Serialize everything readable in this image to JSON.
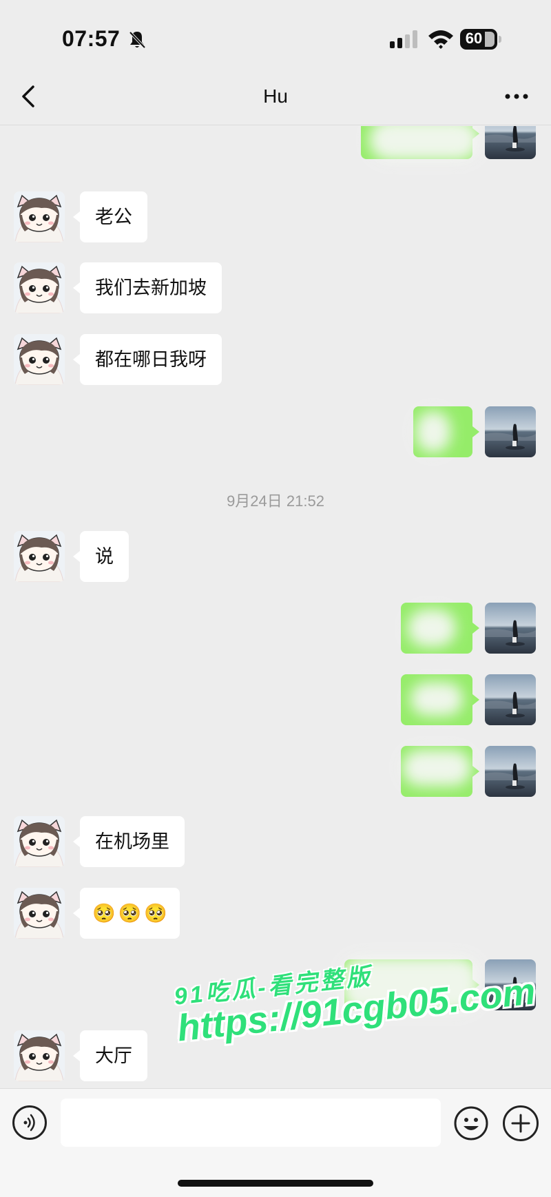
{
  "status_bar": {
    "time": "07:57",
    "battery": "60",
    "icons": [
      "bell-slash-icon",
      "cellular-signal-icon",
      "wifi-icon",
      "battery-icon"
    ]
  },
  "nav": {
    "title": "Hu",
    "back_icon": "chevron-left-icon",
    "more_icon": "more-dots-icon"
  },
  "messages": [
    {
      "side": "left",
      "text": "老公"
    },
    {
      "side": "left",
      "text": "我们去新加坡"
    },
    {
      "side": "left",
      "text": "都在哪日我呀"
    },
    {
      "side": "left",
      "text": "说"
    },
    {
      "side": "left",
      "text": "在机场里"
    },
    {
      "side": "left",
      "text": "大厅"
    }
  ],
  "timestamp": "9月24日 21:52",
  "emoji_message": [
    "🥺",
    "🥺",
    "🥺"
  ],
  "watermark": {
    "line1": "91吃瓜-看完整版",
    "line2": "https://91cgb05.com"
  },
  "input_bar": {
    "placeholder": "",
    "icons": [
      "voice-icon",
      "emoji-icon",
      "plus-icon"
    ]
  },
  "colors": {
    "sent_bubble": "#95ec69",
    "received_bubble": "#ffffff",
    "background": "#ededed",
    "watermark": "#2fe07a"
  }
}
